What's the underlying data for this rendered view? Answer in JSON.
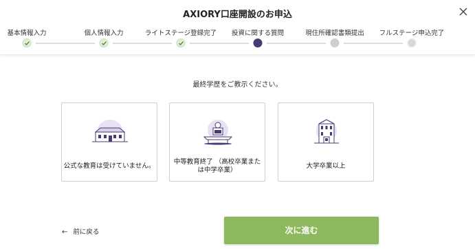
{
  "header": {
    "title": "AXIORY口座開設のお申込"
  },
  "steps": [
    {
      "label": "基本情報入力",
      "status": "done"
    },
    {
      "label": "個人情報入力",
      "status": "done"
    },
    {
      "label": "ライトステージ登録完了",
      "status": "done"
    },
    {
      "label": "投資に関する質問",
      "status": "current"
    },
    {
      "label": "現住所確認書類提出",
      "status": "pending"
    },
    {
      "label": "フルステージ申込完了",
      "status": "pending"
    }
  ],
  "question": {
    "prompt": "最終学歴をご教示ください。"
  },
  "options": [
    {
      "label": "公式な教育は受けていません。",
      "icon": "building-icon"
    },
    {
      "label_line1": "中等教育終了 （高校卒業また",
      "label_line2": "は中学卒業）",
      "icon": "school-desk-icon"
    },
    {
      "label": "大学卒業以上",
      "icon": "university-icon"
    }
  ],
  "footer": {
    "back_label": "前に戻る",
    "next_label": "次に進む"
  },
  "colors": {
    "current_step": "#4a3a73",
    "done_step_bg": "#dfeed8",
    "check": "#5a8a3c",
    "pending_step": "#cfcfcf",
    "next_button": "#8db85e",
    "illustration_bg": "#e6e2f3",
    "illustration_line": "#4a3a73"
  }
}
